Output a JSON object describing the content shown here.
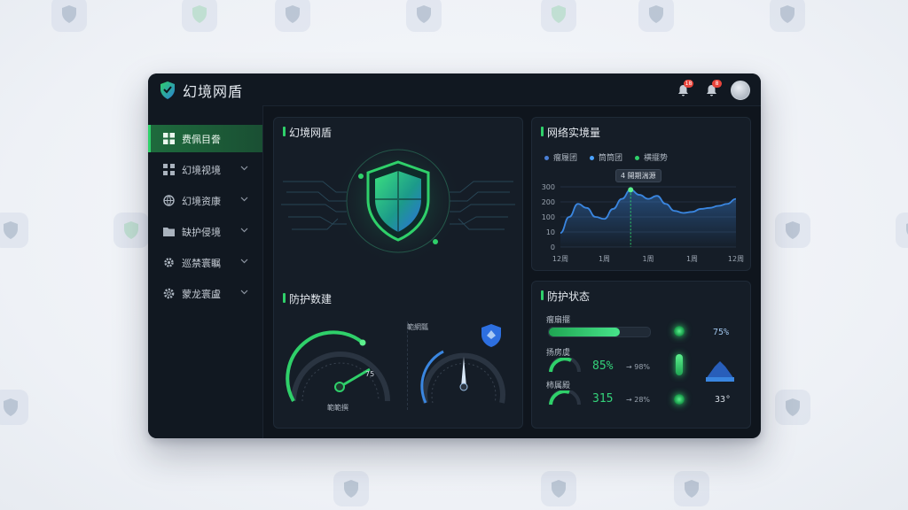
{
  "app": {
    "title": "幻境网盾"
  },
  "topbar": {
    "notifications": [
      {
        "icon": "bell-icon",
        "badge": "18"
      },
      {
        "icon": "bell-icon",
        "badge": "8"
      }
    ],
    "avatar_icon": "user-avatar"
  },
  "sidebar": {
    "items": [
      {
        "label": "费佩目誊",
        "icon": "grid-icon",
        "active": true
      },
      {
        "label": "幻境视境",
        "icon": "apps-icon"
      },
      {
        "label": "幻境资康",
        "icon": "globe-icon"
      },
      {
        "label": "缺护侵境",
        "icon": "folder-icon"
      },
      {
        "label": "巡禁寰瞩",
        "icon": "gear-icon"
      },
      {
        "label": "蒙龙寰盧",
        "icon": "settings-icon"
      }
    ]
  },
  "shield_panel": {
    "title": "幻境网盾"
  },
  "network_panel": {
    "title": "网络实境量",
    "legend": [
      {
        "label": "瘤履团",
        "color": "#4a7fd6"
      },
      {
        "label": "筒筒团",
        "color": "#4aa3ff"
      },
      {
        "label": "横擺势",
        "color": "#2fd06a"
      }
    ],
    "tooltip": "4 開期湍源"
  },
  "protect_data_panel": {
    "title": "防护数建",
    "gauge1_label": "範範撰",
    "gauge1_tick": "75",
    "gauge2_label": "範網瓢"
  },
  "status_panel": {
    "title": "防护状态",
    "row1_label": "瘤扇擺",
    "row2_label": "扬房虞",
    "row2_value": "85%",
    "row2_sub": "→ 98%",
    "row3_label": "柿属殿",
    "row3_value": "315",
    "row3_sub": "→ 28%",
    "right1_value": "75%",
    "right3_value": "33°",
    "progress": 0.7
  },
  "chart_data": {
    "type": "line",
    "title": "网络实境量",
    "x_ticks": [
      "12周",
      "1周",
      "1周",
      "1周",
      "12周"
    ],
    "y_ticks": [
      "0",
      "10",
      "100",
      "200",
      "300"
    ],
    "series": [
      {
        "name": "横擺势",
        "color": "#3a86e0",
        "x": [
          0,
          0.05,
          0.1,
          0.15,
          0.2,
          0.25,
          0.3,
          0.35,
          0.4,
          0.45,
          0.5,
          0.55,
          0.6,
          0.65,
          0.7,
          0.75,
          0.8,
          0.85,
          0.9,
          0.95,
          1.0
        ],
        "values": [
          70,
          150,
          215,
          195,
          150,
          140,
          190,
          240,
          285,
          260,
          240,
          255,
          215,
          180,
          170,
          175,
          190,
          195,
          205,
          215,
          240
        ]
      }
    ],
    "ylim": [
      0,
      300
    ],
    "grid": true
  },
  "colors": {
    "accent": "#2fd06a",
    "panel": "#151d27",
    "background": "#0f151d",
    "line": "#3a86e0"
  }
}
